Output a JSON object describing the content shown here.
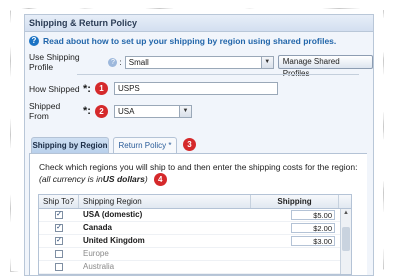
{
  "panel": {
    "title": "Shipping & Return Policy",
    "help_text": "Read about how to set up your shipping by region using shared profiles."
  },
  "profile": {
    "label": "Use Shipping Profile",
    "selected": "Small",
    "manage_button": "Manage Shared Profiles"
  },
  "how_shipped": {
    "label": "How Shipped",
    "value": "USPS",
    "badge": "1"
  },
  "shipped_from": {
    "label": "Shipped From",
    "value": "USA",
    "badge": "2"
  },
  "tabs": [
    {
      "label": "Shipping by Region"
    },
    {
      "label": "Return Policy *"
    }
  ],
  "tabs_badge": "3",
  "instructions": {
    "line1": "Check which regions you will ship to and then enter the shipping costs for the region:",
    "line2_prefix": "(all currency is in ",
    "line2_bold": "US dollars",
    "line2_suffix": ")",
    "badge": "4"
  },
  "grid": {
    "headers": [
      "Ship To?",
      "Shipping Region",
      "Shipping"
    ],
    "rows": [
      {
        "checked": true,
        "region": "USA (domestic)",
        "price": "$5.00",
        "bold": true
      },
      {
        "checked": true,
        "region": "Canada",
        "price": "$2.00",
        "bold": true
      },
      {
        "checked": true,
        "region": "United Kingdom",
        "price": "$3.00",
        "bold": true
      },
      {
        "checked": false,
        "region": "Europe",
        "price": "",
        "bold": false
      },
      {
        "checked": false,
        "region": "Australia",
        "price": "",
        "bold": false
      }
    ]
  },
  "colors": {
    "accent": "#2266aa",
    "badge": "#d5292b",
    "panel_bg": "#f1f5fb"
  }
}
